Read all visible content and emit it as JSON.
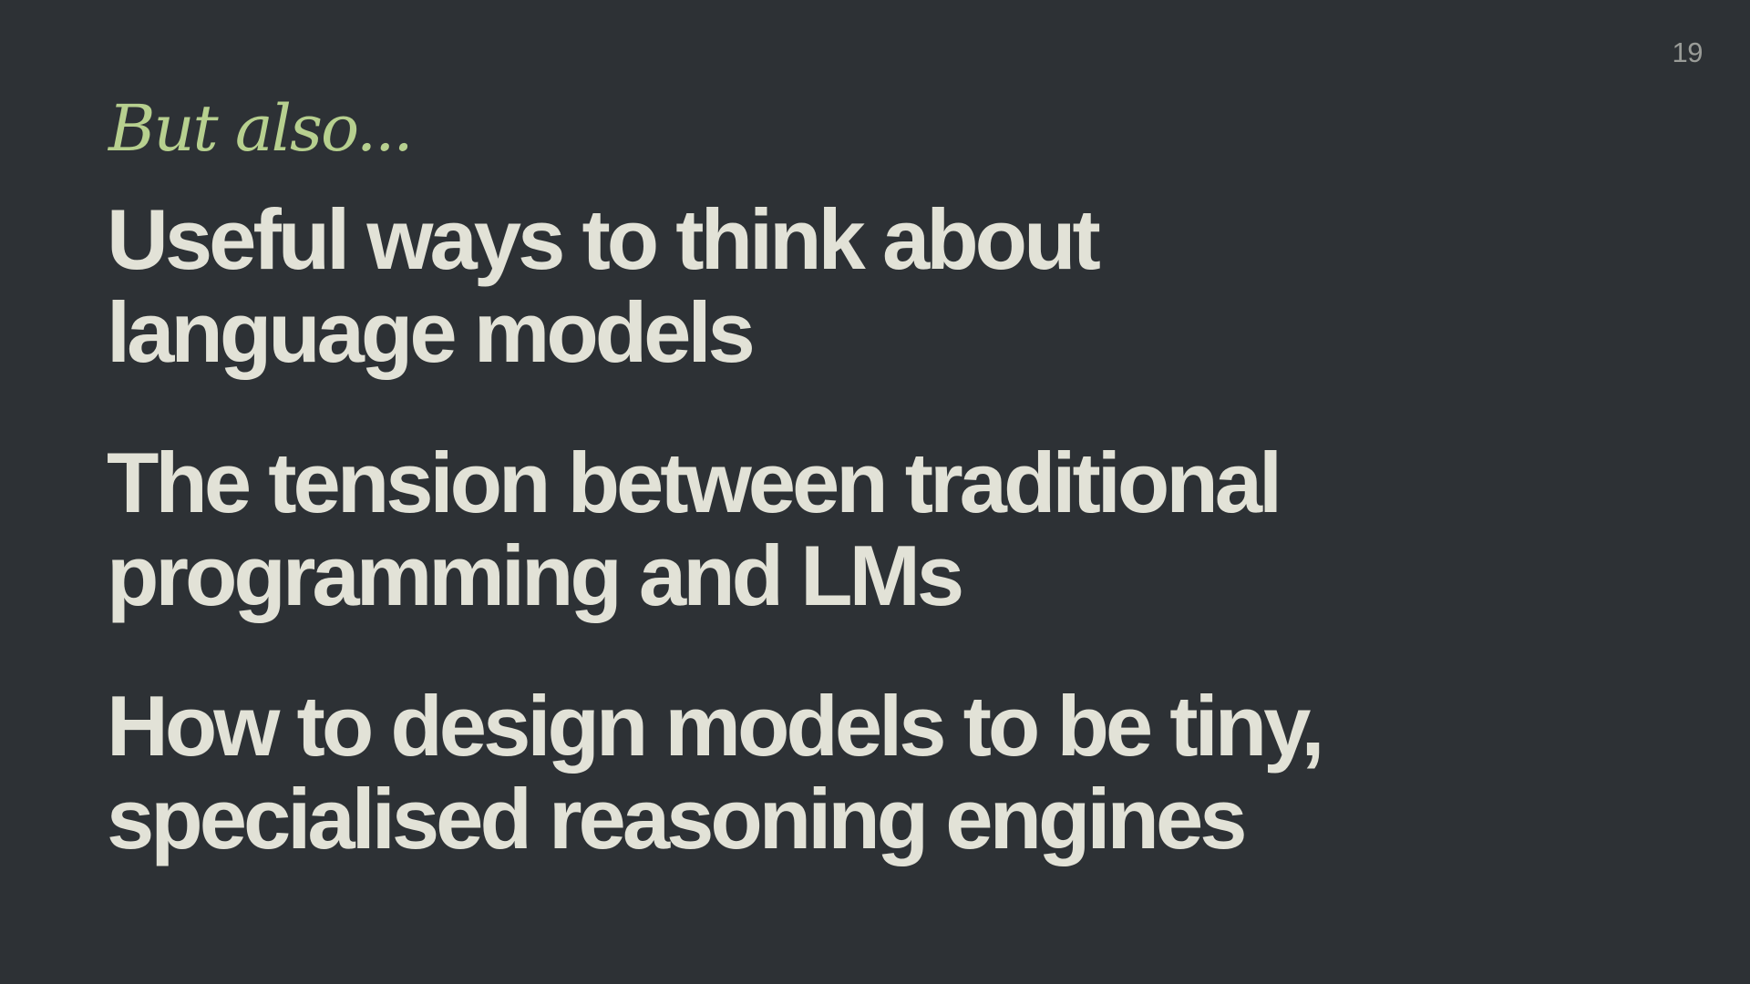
{
  "slide": {
    "page_number": "19",
    "kicker": "But also...",
    "points": [
      {
        "lines": [
          "Useful ways to think about",
          "language models"
        ]
      },
      {
        "lines": [
          "The tension between traditional",
          "programming and LMs"
        ]
      },
      {
        "lines": [
          "How to design models to be tiny,",
          "specialised reasoning engines"
        ]
      }
    ]
  },
  "colors": {
    "background": "#2d3135",
    "accent": "#b7d08f",
    "text": "#e2e2d7",
    "page_number": "#9a9c98"
  }
}
